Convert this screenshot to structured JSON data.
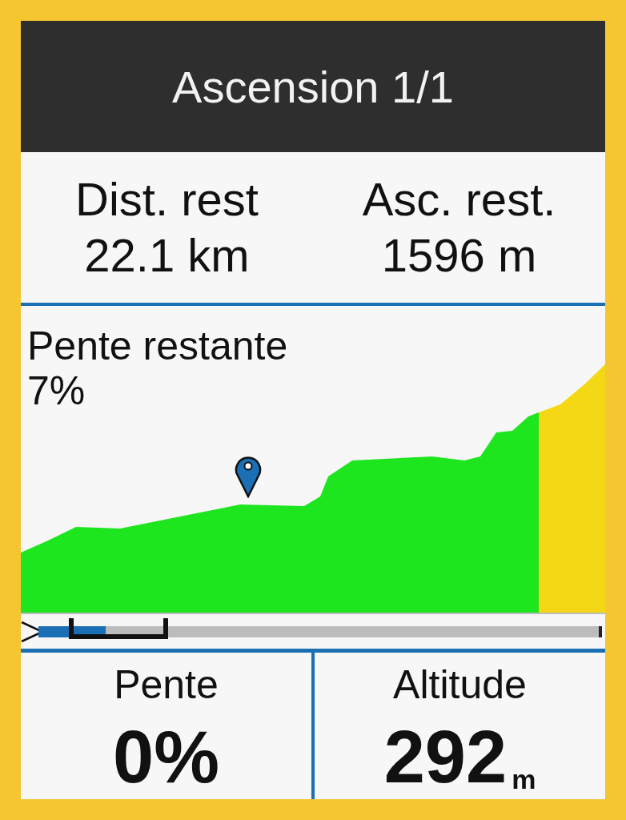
{
  "header": {
    "title": "Ascension 1/1"
  },
  "stats": [
    {
      "label": "Dist. rest",
      "value": "22.1 km"
    },
    {
      "label": "Asc. rest.",
      "value": "1596 m"
    }
  ],
  "profile": {
    "label": "Pente restante",
    "value": "7%"
  },
  "progress": {
    "level": 0.12
  },
  "fields": [
    {
      "label": "Pente",
      "value": "0%"
    },
    {
      "label": "Altitude",
      "value": "292",
      "unit": "m"
    }
  ]
}
